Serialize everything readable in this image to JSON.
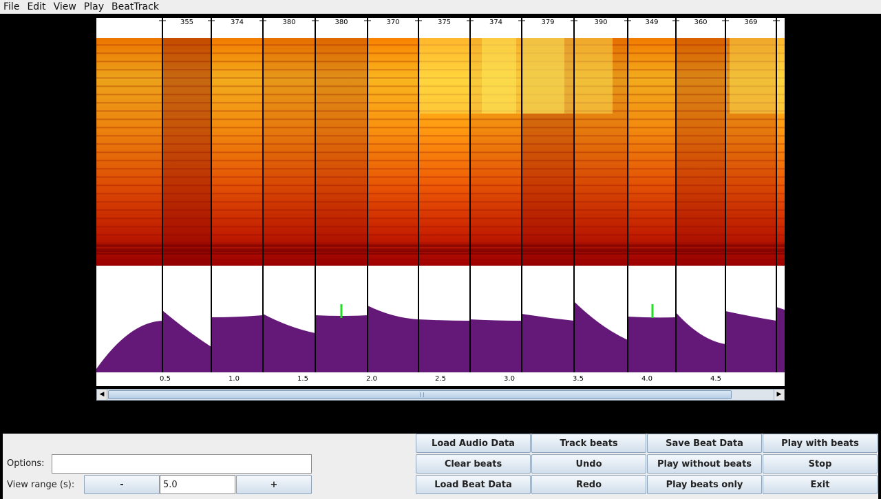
{
  "menu": [
    {
      "label": "File"
    },
    {
      "label": "Edit"
    },
    {
      "label": "View"
    },
    {
      "label": "Play"
    },
    {
      "label": "BeatTrack"
    }
  ],
  "beat_intervals": [
    "355",
    "374",
    "380",
    "380",
    "370",
    "375",
    "374",
    "379",
    "390",
    "349",
    "360",
    "369"
  ],
  "time_ticks": [
    "0.5",
    "1.0",
    "1.5",
    "2.0",
    "2.5",
    "3.0",
    "3.5",
    "4.0",
    "4.5"
  ],
  "colors": {
    "waveform": "#641878",
    "onset_marker": "#22dd22",
    "beat_line": "#000000",
    "spectrogram_low": "#a00000",
    "spectrogram_high": "#ffe040"
  },
  "controls": {
    "options_label": "Options:",
    "options_value": "",
    "view_range_label": "View range (s):",
    "minus_label": "-",
    "plus_label": "+",
    "view_range_value": "5.0"
  },
  "buttons": {
    "load_audio": "Load Audio Data",
    "track_beats": "Track beats",
    "save_beat": "Save Beat Data",
    "play_with_beats": "Play with beats",
    "clear_beats": "Clear beats",
    "undo": "Undo",
    "play_without_beats": "Play without beats",
    "stop": "Stop",
    "load_beat": "Load Beat Data",
    "redo": "Redo",
    "play_beats_only": "Play beats only",
    "exit": "Exit"
  },
  "scrollbar": {
    "left_arrow_icon": "triangle-left",
    "right_arrow_icon": "triangle-right"
  }
}
